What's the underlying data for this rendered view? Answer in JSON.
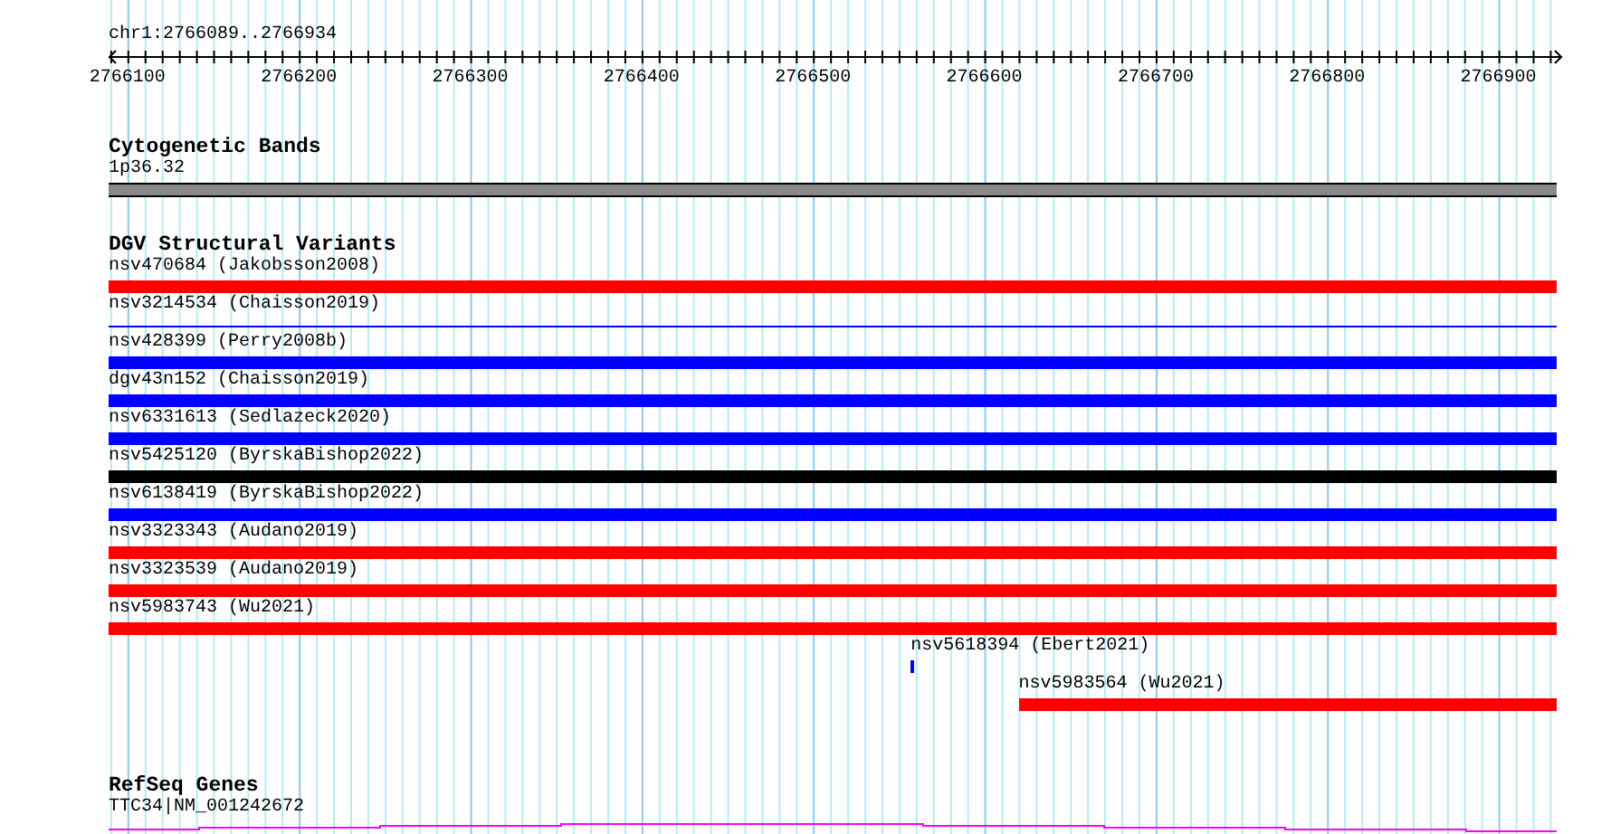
{
  "view": {
    "location": "chr1:2766089..2766934",
    "ticks": [
      "2766100",
      "2766200",
      "2766300",
      "2766400",
      "2766500",
      "2766600",
      "2766700",
      "2766800",
      "2766900"
    ]
  },
  "cytobands": {
    "title": "Cytogenetic Bands",
    "band": "1p36.32"
  },
  "dgv": {
    "title": "DGV Structural Variants",
    "features": [
      {
        "label": "nsv470684 (Jakobsson2008)",
        "color": "#ff0000",
        "kind": "thick"
      },
      {
        "label": "nsv3214534 (Chaisson2019)",
        "color": "#0000ff",
        "kind": "thin"
      },
      {
        "label": "nsv428399 (Perry2008b)",
        "color": "#0000ff",
        "kind": "thick"
      },
      {
        "label": "dgv43n152 (Chaisson2019)",
        "color": "#0000ff",
        "kind": "thick"
      },
      {
        "label": "nsv6331613 (Sedlazeck2020)",
        "color": "#0000ff",
        "kind": "thick"
      },
      {
        "label": "nsv5425120 (ByrskaBishop2022)",
        "color": "#000000",
        "kind": "thick"
      },
      {
        "label": "nsv6138419 (ByrskaBishop2022)",
        "color": "#0000ff",
        "kind": "thick"
      },
      {
        "label": "nsv3323343 (Audano2019)",
        "color": "#ff0000",
        "kind": "thick"
      },
      {
        "label": "nsv3323539 (Audano2019)",
        "color": "#ff0000",
        "kind": "thick"
      },
      {
        "label": "nsv5983743 (Wu2021)",
        "color": "#ff0000",
        "kind": "thick"
      },
      {
        "label": "nsv5618394 (Ebert2021)",
        "color": "#0000ff",
        "kind": "thick"
      },
      {
        "label": "nsv5983564 (Wu2021)",
        "color": "#ff0000",
        "kind": "thick"
      }
    ]
  },
  "refseq": {
    "title": "RefSeq Genes",
    "gene": "TTC34|NM_001242672"
  }
}
